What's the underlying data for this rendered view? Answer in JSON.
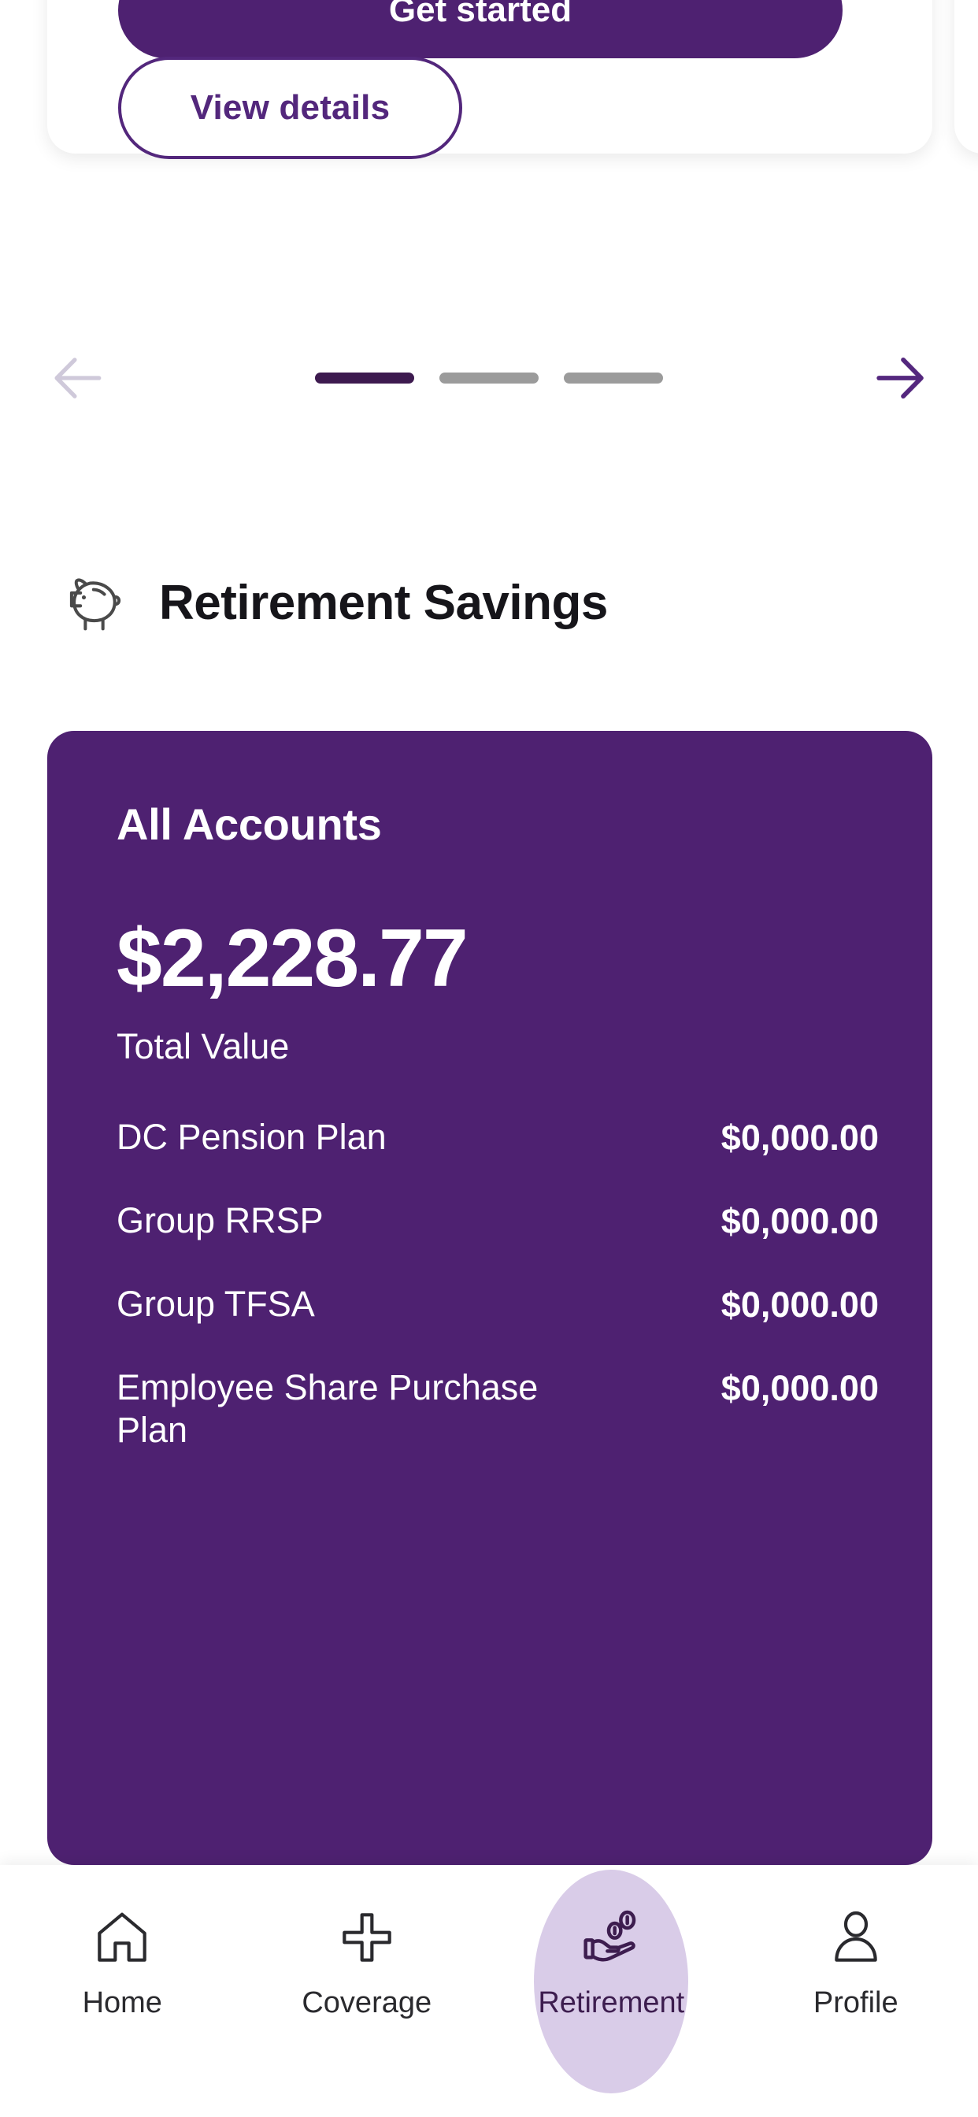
{
  "carousel": {
    "primary_cta_label": "Get started",
    "secondary_cta_label": "View details",
    "prev_arrow_icon": "arrow-left-icon",
    "next_arrow_icon": "arrow-right-icon",
    "dots": [
      {
        "active": true
      },
      {
        "active": false
      },
      {
        "active": false
      }
    ],
    "active_index": 0,
    "total_slides": 3
  },
  "section": {
    "icon": "piggy-bank-icon",
    "title": "Retirement Savings"
  },
  "accounts_card": {
    "title": "All Accounts",
    "total_value": "$2,228.77",
    "total_value_label": "Total Value",
    "accent_color": "#4e2171",
    "rows": [
      {
        "name": "DC Pension Plan",
        "amount": "$0,000.00"
      },
      {
        "name": "Group RRSP",
        "amount": "$0,000.00"
      },
      {
        "name": "Group TFSA",
        "amount": "$0,000.00"
      },
      {
        "name": "Employee Share Purchase Plan",
        "amount": "$0,000.00"
      }
    ]
  },
  "bottom_nav": {
    "active_pill_color": "#d9cce8",
    "items": [
      {
        "label": "Home",
        "icon": "home-icon",
        "active": false
      },
      {
        "label": "Coverage",
        "icon": "plus-icon",
        "active": false
      },
      {
        "label": "Retirement",
        "icon": "hand-coins-icon",
        "active": true
      },
      {
        "label": "Profile",
        "icon": "person-icon",
        "active": false
      }
    ]
  },
  "colors": {
    "brand_purple": "#4e2171",
    "dark_purple": "#3d1a4f",
    "arrow_active": "#54277e",
    "arrow_disabled": "#cfc9da",
    "dot_inactive": "#9b9b9b",
    "page_background": "#ffffff"
  }
}
